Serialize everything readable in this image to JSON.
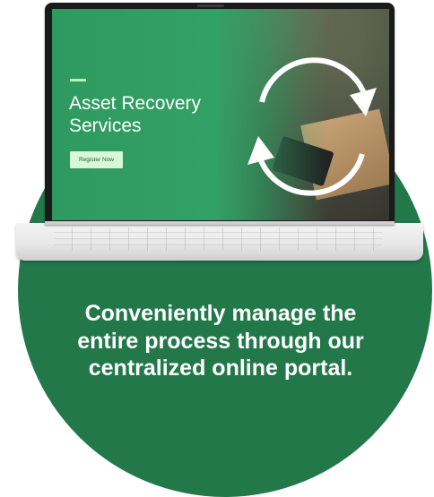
{
  "screen": {
    "title": "Asset Recovery Services",
    "register_label": "Register Now"
  },
  "caption": "Conveniently manage the entire process through our centralized online portal.",
  "colors": {
    "circle": "#23784a",
    "screen_green": "#33a065",
    "button_bg": "#d9f8d6",
    "accent_bar": "#b8f2b8"
  },
  "icons": {
    "recycle": "recycle-arrows-icon"
  }
}
